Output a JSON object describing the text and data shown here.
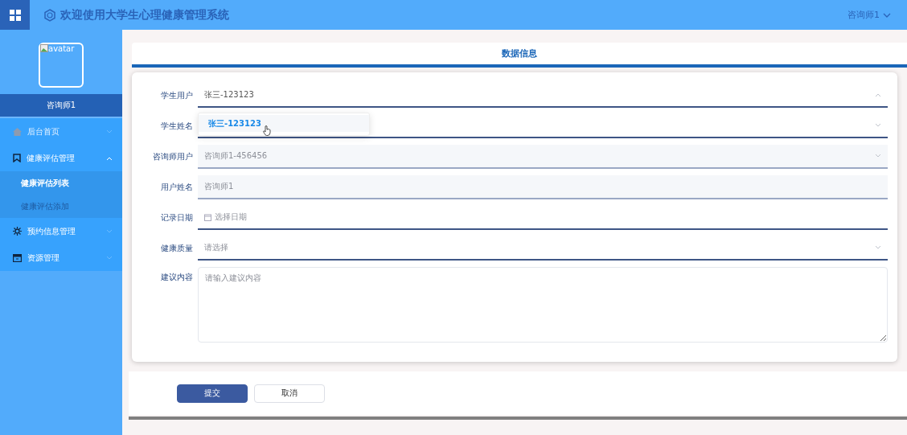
{
  "header": {
    "title": "欢迎使用大学生心理健康管理系统",
    "user": "咨询师1"
  },
  "sidebar": {
    "avatar_alt": "avatar",
    "user_name": "咨询师1",
    "items": [
      {
        "label": "后台首页",
        "expanded": false
      },
      {
        "label": "健康评估管理",
        "expanded": true,
        "children": [
          {
            "label": "健康评估列表",
            "selected": true
          },
          {
            "label": "健康评估添加",
            "selected": false
          }
        ]
      },
      {
        "label": "预约信息管理",
        "expanded": false
      },
      {
        "label": "资源管理",
        "expanded": false
      }
    ]
  },
  "page_title": "数据信息",
  "form": {
    "fields": [
      {
        "label": "学生用户",
        "kind": "select",
        "value": "张三-123123",
        "disabled": false,
        "expanded": true
      },
      {
        "label": "学生姓名",
        "kind": "select",
        "disabled": false,
        "expanded": false
      },
      {
        "label": "咨询师用户",
        "kind": "select",
        "value": "咨询师1-456456",
        "disabled": true,
        "expanded": false
      },
      {
        "label": "用户姓名",
        "kind": "input",
        "value": "咨询师1",
        "disabled": true
      },
      {
        "label": "记录日期",
        "kind": "date",
        "placeholder": "选择日期",
        "disabled": false
      },
      {
        "label": "健康质量",
        "kind": "select",
        "placeholder": "请选择",
        "disabled": false,
        "expanded": false
      },
      {
        "label": "建议内容",
        "kind": "textarea",
        "placeholder": "请输入建议内容"
      }
    ],
    "dropdown": {
      "options": [
        {
          "label": "张三-123123",
          "selected": true
        }
      ]
    },
    "buttons": [
      {
        "label": "提交",
        "kind": "primary"
      },
      {
        "label": "取消",
        "kind": "plain"
      }
    ]
  }
}
